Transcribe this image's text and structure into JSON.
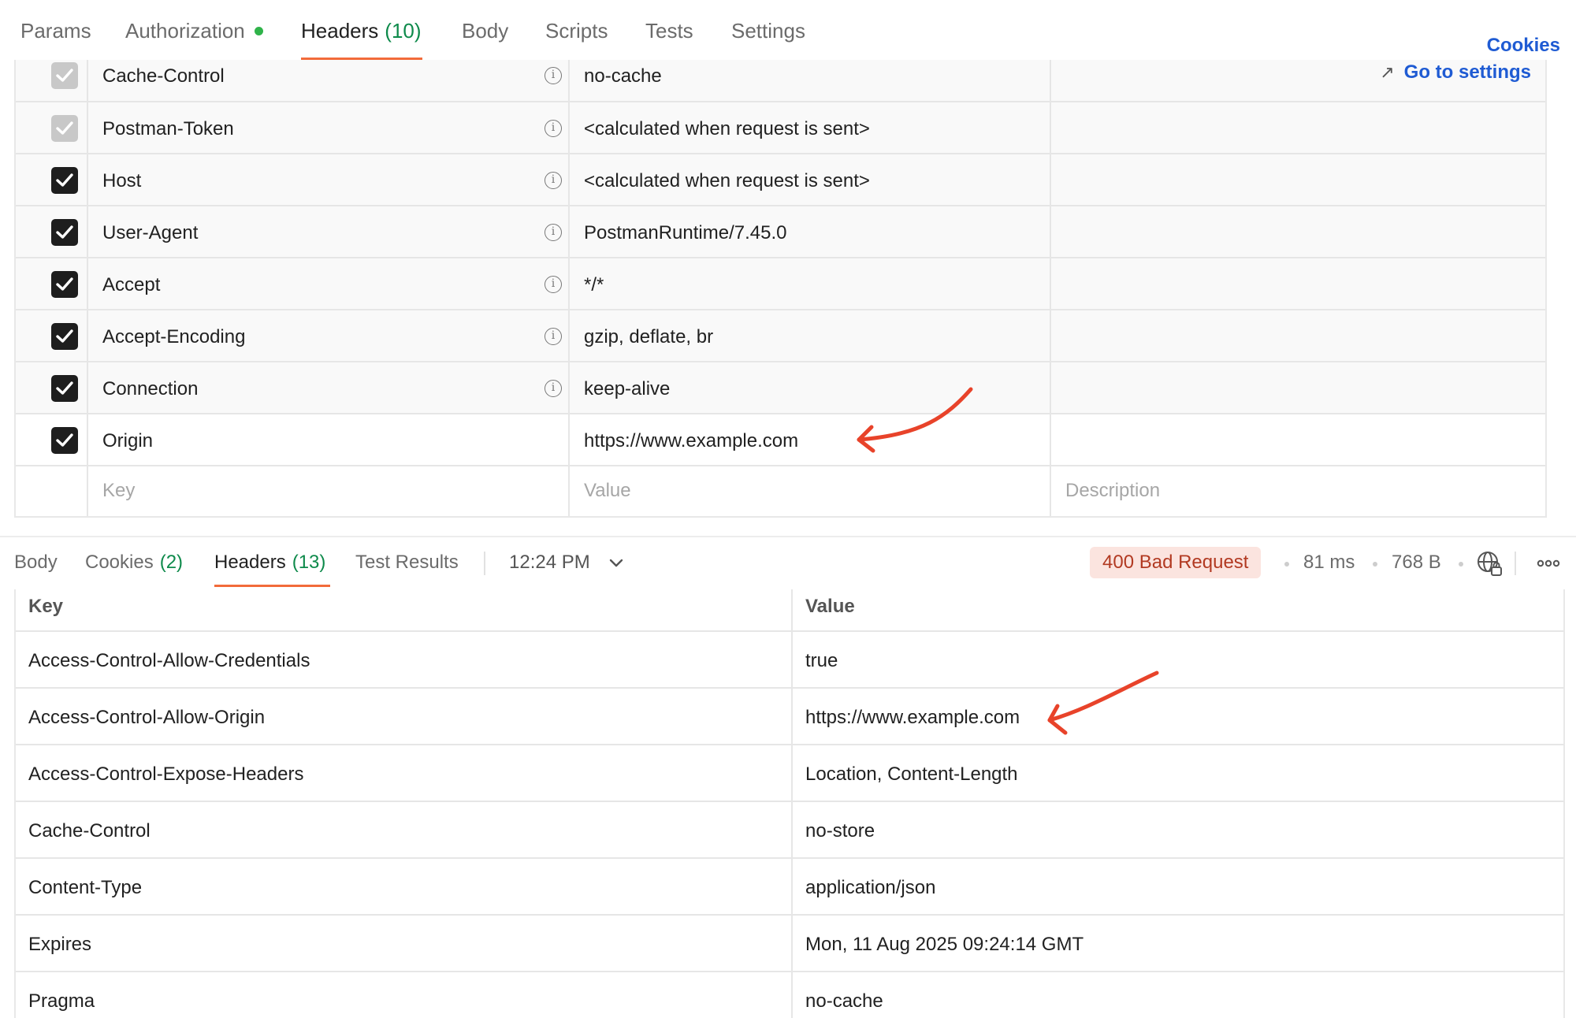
{
  "request_tabs": {
    "params": "Params",
    "authorization": "Authorization",
    "headers": "Headers",
    "headers_count": "(10)",
    "body": "Body",
    "scripts": "Scripts",
    "tests": "Tests",
    "settings": "Settings"
  },
  "cookies_link": "Cookies",
  "go_to_settings": "Go to settings",
  "request_headers": [
    {
      "key": "Cache-Control",
      "value": "no-cache",
      "checked": true,
      "auto": true
    },
    {
      "key": "Postman-Token",
      "value": "<calculated when request is sent>",
      "checked": true,
      "auto": true
    },
    {
      "key": "Host",
      "value": "<calculated when request is sent>",
      "checked": true,
      "auto": false
    },
    {
      "key": "User-Agent",
      "value": "PostmanRuntime/7.45.0",
      "checked": true,
      "auto": false
    },
    {
      "key": "Accept",
      "value": "*/*",
      "checked": true,
      "auto": false
    },
    {
      "key": "Accept-Encoding",
      "value": "gzip, deflate, br",
      "checked": true,
      "auto": false
    },
    {
      "key": "Connection",
      "value": "keep-alive",
      "checked": true,
      "auto": false
    },
    {
      "key": "Origin",
      "value": "https://www.example.com",
      "checked": true,
      "auto": false
    }
  ],
  "new_row": {
    "key_placeholder": "Key",
    "value_placeholder": "Value",
    "description_placeholder": "Description"
  },
  "response_tabs": {
    "body": "Body",
    "cookies": "Cookies",
    "cookies_count": "(2)",
    "headers": "Headers",
    "headers_count": "(13)",
    "test_results": "Test Results"
  },
  "response_time_label": "12:24 PM",
  "response_status": "400 Bad Request",
  "response_duration": "81 ms",
  "response_size": "768 B",
  "response_headers_columns": {
    "key": "Key",
    "value": "Value"
  },
  "response_headers": [
    {
      "key": "Access-Control-Allow-Credentials",
      "value": "true"
    },
    {
      "key": "Access-Control-Allow-Origin",
      "value": "https://www.example.com"
    },
    {
      "key": "Access-Control-Expose-Headers",
      "value": "Location, Content-Length"
    },
    {
      "key": "Cache-Control",
      "value": "no-store"
    },
    {
      "key": "Content-Type",
      "value": "application/json"
    },
    {
      "key": "Expires",
      "value": "Mon, 11 Aug 2025 09:24:14 GMT"
    },
    {
      "key": "Pragma",
      "value": "no-cache"
    }
  ],
  "colors": {
    "accent_tab_underline": "#f26b3a",
    "link_blue": "#1f5bd3",
    "count_green": "#0e8a4b",
    "status_error_bg": "#fbe4df",
    "status_error_text": "#b23a22",
    "annotation_arrow": "#e8432a"
  }
}
